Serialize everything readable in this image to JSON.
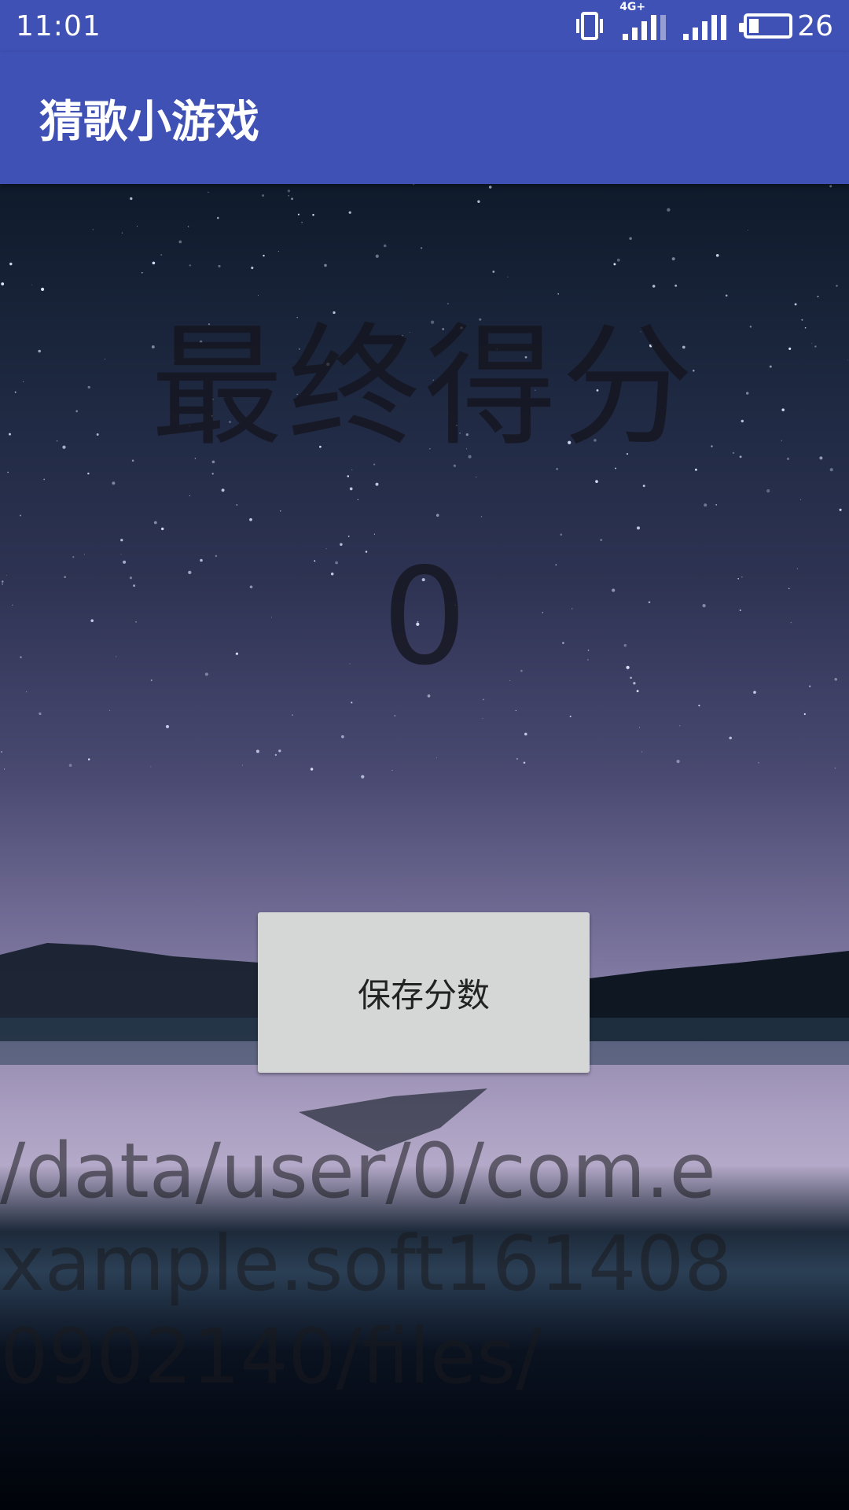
{
  "status_bar": {
    "time": "11:01",
    "network_type": "4G+",
    "battery_level": "26",
    "battery_fraction": 0.26,
    "icons": [
      "vibrate-icon",
      "signal-4g-icon",
      "signal-icon",
      "battery-icon"
    ]
  },
  "app_bar": {
    "title": "猜歌小游戏"
  },
  "main": {
    "score_label": "最终得分",
    "score_value": "0",
    "save_button_label": "保存分数",
    "file_path": "/data/user/0/com.example.soft1614080902140/files/"
  },
  "colors": {
    "primary": "#3f51b5",
    "button_bg": "#d5d6d6"
  }
}
